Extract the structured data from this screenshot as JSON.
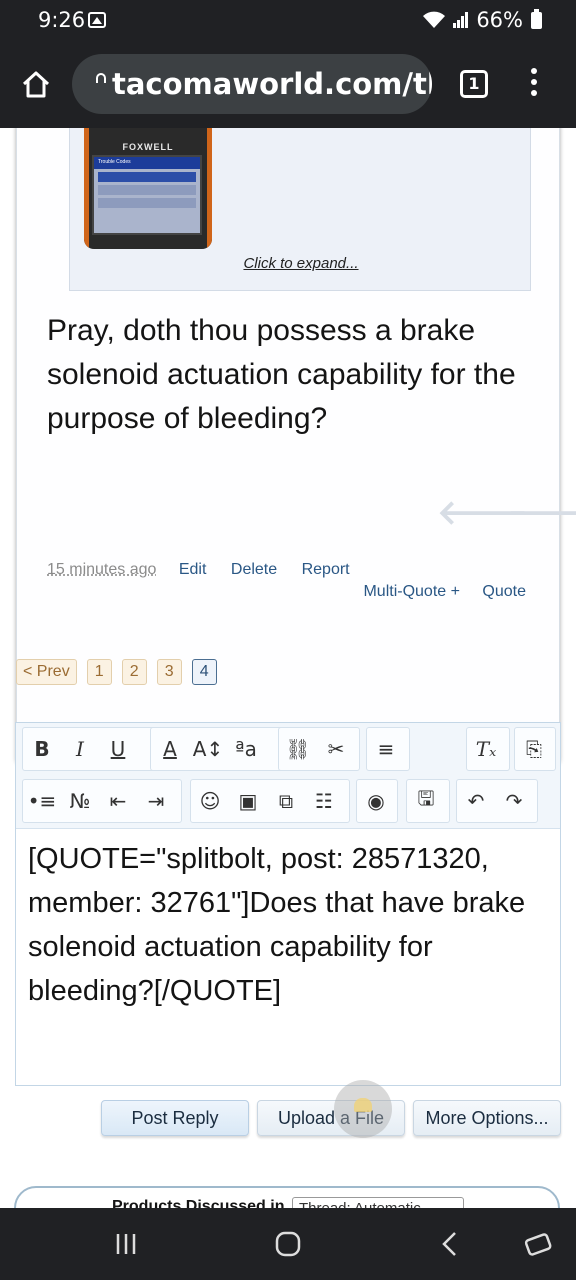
{
  "status_bar": {
    "time": "9:26",
    "battery": "66%"
  },
  "browser": {
    "url": "tacomaworld.com/th",
    "tab_count": "1"
  },
  "post": {
    "quote": {
      "image_brand": "FOXWELL",
      "image_screen_title": "Trouble Codes",
      "expand_label": "Click to expand..."
    },
    "text": "Pray, doth thou possess a brake solenoid actuation capability for the purpose of bleeding?",
    "timestamp": "15 minutes ago",
    "actions": [
      "Edit",
      "Delete",
      "Report"
    ],
    "actions2": [
      "Multi-Quote +",
      "Quote"
    ]
  },
  "pagination": {
    "prev": "< Prev",
    "pages": [
      "1",
      "2",
      "3",
      "4"
    ],
    "current": "4"
  },
  "editor": {
    "toolbar_row1": [
      "B",
      "I",
      "U",
      "A",
      "A↕",
      "ªa",
      "link-icon",
      "unlink-icon",
      "align-icon",
      "clear-format-icon",
      "code-icon"
    ],
    "text": "[QUOTE=\"splitbolt, post: 28571320, member: 32761\"]Does that have brake solenoid actuation capability for bleeding?[/QUOTE]"
  },
  "buttons": {
    "post_reply": "Post Reply",
    "upload_file": "Upload a File",
    "more_options": "More Options..."
  },
  "products": {
    "label": "Products Discussed in",
    "select_value": "Thread: Automatic"
  }
}
